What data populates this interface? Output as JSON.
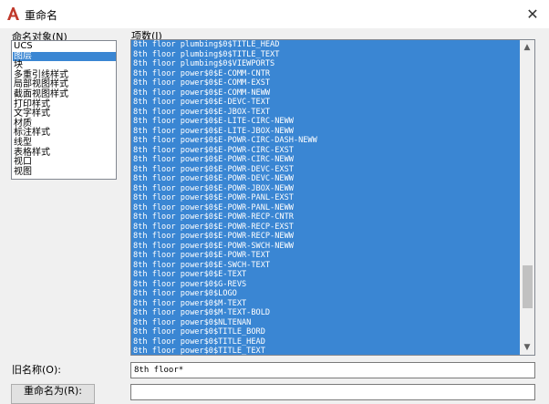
{
  "window": {
    "title": "重命名",
    "close_glyph": "✕",
    "app_icon_color": "#c0392b",
    "accent": "#3a86d3"
  },
  "named_objects": {
    "label": "命名对象(N)",
    "selected_index": 1,
    "items": [
      "UCS",
      "图层",
      "块",
      "多重引线样式",
      "局部视图样式",
      "截面视图样式",
      "打印样式",
      "文字样式",
      "材质",
      "标注样式",
      "线型",
      "表格样式",
      "视口",
      "视图"
    ]
  },
  "entries": {
    "label": "项数(I)",
    "rows": [
      "8th floor plumbing$0$TITLE_HEAD",
      "8th floor plumbing$0$TITLE_TEXT",
      "8th floor plumbing$0$VIEWPORTS",
      "8th floor power$0$E-COMM-CNTR",
      "8th floor power$0$E-COMM-EXST",
      "8th floor power$0$E-COMM-NEWW",
      "8th floor power$0$E-DEVC-TEXT",
      "8th floor power$0$E-JBOX-TEXT",
      "8th floor power$0$E-LITE-CIRC-NEWW",
      "8th floor power$0$E-LITE-JBOX-NEWW",
      "8th floor power$0$E-POWR-CIRC-DASH-NEWW",
      "8th floor power$0$E-POWR-CIRC-EXST",
      "8th floor power$0$E-POWR-CIRC-NEWW",
      "8th floor power$0$E-POWR-DEVC-EXST",
      "8th floor power$0$E-POWR-DEVC-NEWW",
      "8th floor power$0$E-POWR-JBOX-NEWW",
      "8th floor power$0$E-POWR-PANL-EXST",
      "8th floor power$0$E-POWR-PANL-NEWW",
      "8th floor power$0$E-POWR-RECP-CNTR",
      "8th floor power$0$E-POWR-RECP-EXST",
      "8th floor power$0$E-POWR-RECP-NEWW",
      "8th floor power$0$E-POWR-SWCH-NEWW",
      "8th floor power$0$E-POWR-TEXT",
      "8th floor power$0$E-SWCH-TEXT",
      "8th floor power$0$E-TEXT",
      "8th floor power$0$G-REVS",
      "8th floor power$0$LOGO",
      "8th floor power$0$M-TEXT",
      "8th floor power$0$M-TEXT-BOLD",
      "8th floor power$0$NLTENAN",
      "8th floor power$0$TITLE_BORD",
      "8th floor power$0$TITLE_HEAD",
      "8th floor power$0$TITLE_TEXT"
    ],
    "scroll_up_glyph": "▲",
    "scroll_down_glyph": "▼"
  },
  "old_name": {
    "label": "旧名称(O):",
    "value": "8th floor*"
  },
  "rename": {
    "button_label": "重命名为(R):",
    "value": ""
  }
}
